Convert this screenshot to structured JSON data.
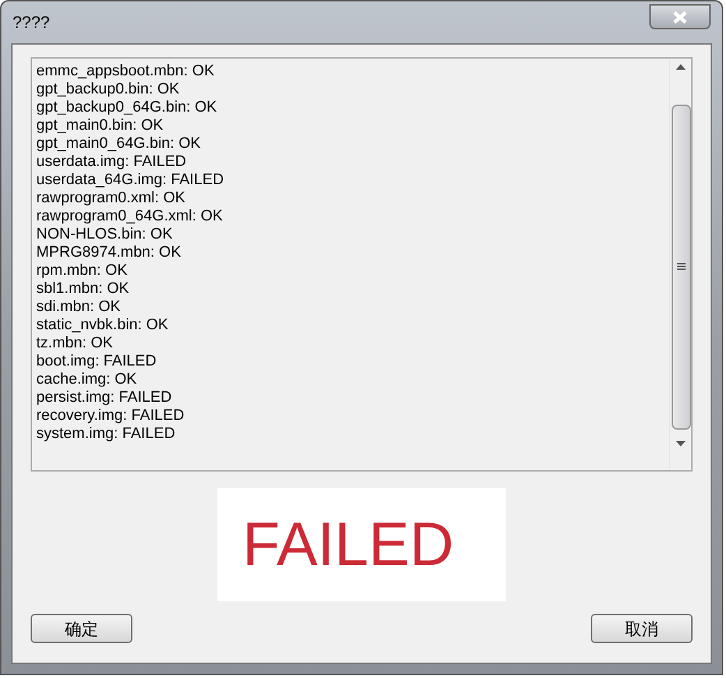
{
  "window": {
    "title": "????"
  },
  "log": {
    "lines": [
      "emmc_appsboot.mbn: OK",
      "gpt_backup0.bin: OK",
      "gpt_backup0_64G.bin: OK",
      "gpt_main0.bin: OK",
      "gpt_main0_64G.bin: OK",
      "userdata.img: FAILED",
      "userdata_64G.img: FAILED",
      "rawprogram0.xml: OK",
      "rawprogram0_64G.xml: OK",
      "NON-HLOS.bin: OK",
      "MPRG8974.mbn: OK",
      "rpm.mbn: OK",
      "sbl1.mbn: OK",
      "sdi.mbn: OK",
      "static_nvbk.bin: OK",
      "tz.mbn: OK",
      "boot.img: FAILED",
      "cache.img: OK",
      "persist.img: FAILED",
      "recovery.img: FAILED",
      "system.img: FAILED"
    ]
  },
  "result": {
    "text": "FAILED"
  },
  "buttons": {
    "ok": "确定",
    "cancel": "取消"
  }
}
